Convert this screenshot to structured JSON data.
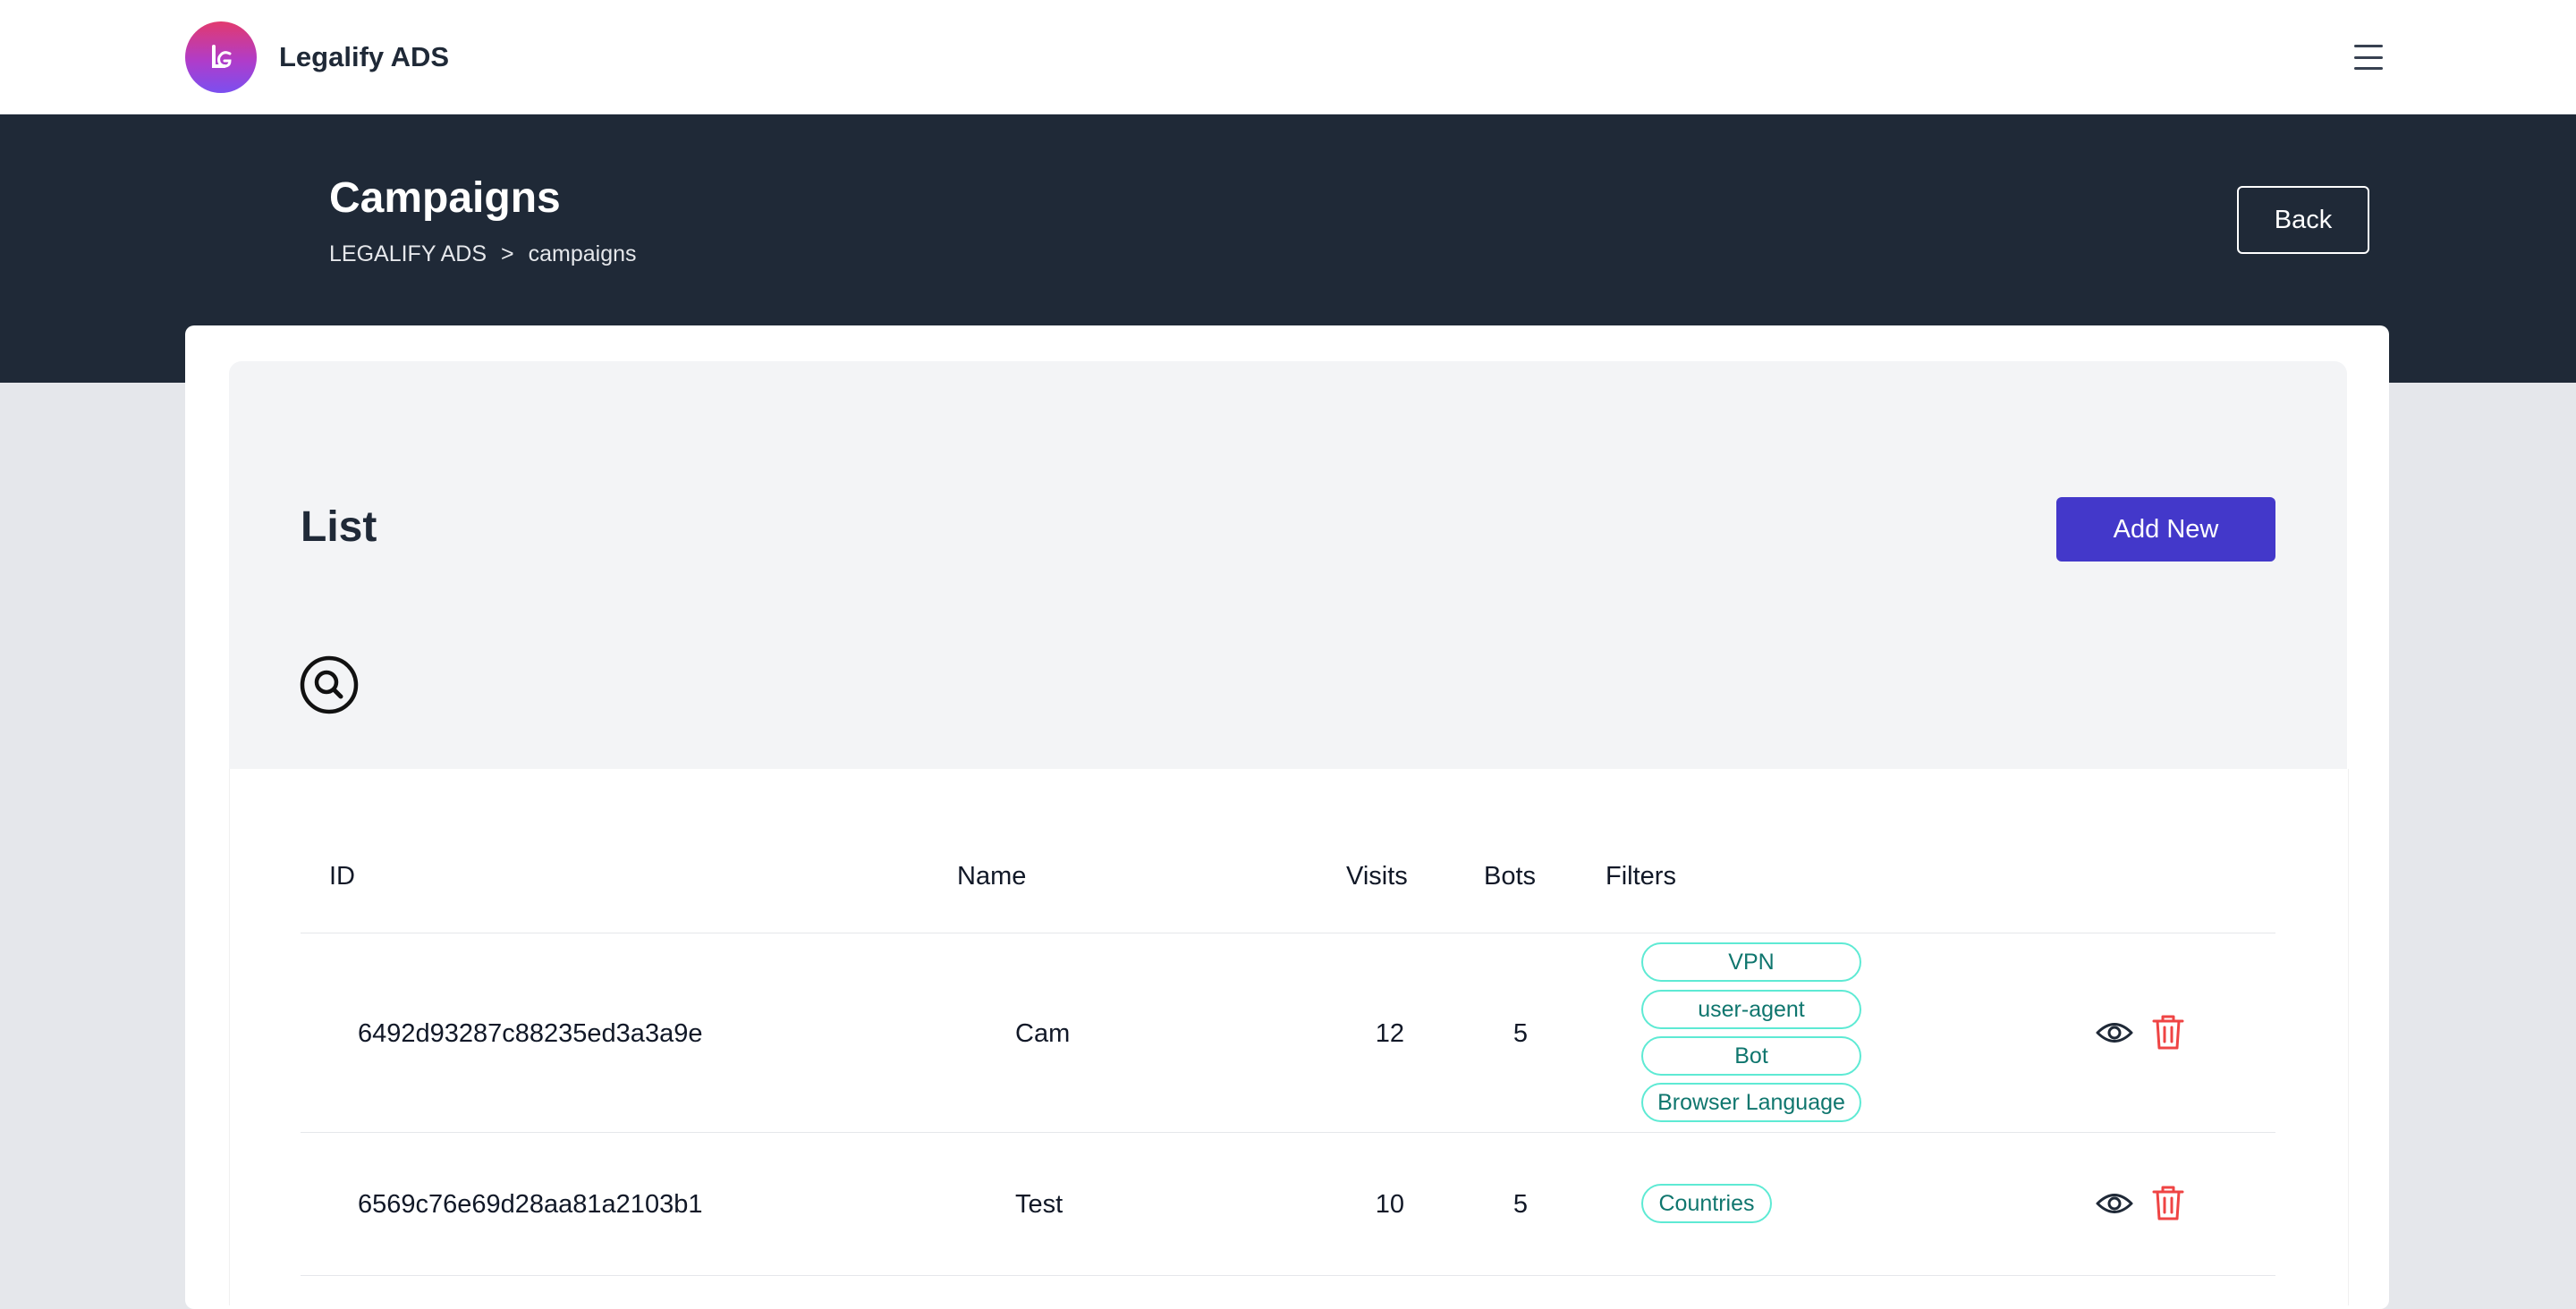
{
  "brand": {
    "name": "Legalify ADS",
    "logo_letter": "LG"
  },
  "header": {
    "title": "Campaigns",
    "breadcrumb": [
      "LEGALIFY ADS",
      ">",
      "campaigns"
    ],
    "back_label": "Back"
  },
  "list": {
    "title": "List",
    "add_label": "Add New"
  },
  "table": {
    "columns": [
      "ID",
      "Name",
      "Visits",
      "Bots",
      "Filters"
    ],
    "rows": [
      {
        "id": "6492d93287c88235ed3a3a9e",
        "name": "Cam",
        "visits": "12",
        "bots": "5",
        "filters": [
          "VPN",
          "user-agent",
          "Bot",
          "Browser Language"
        ]
      },
      {
        "id": "6569c76e69d28aa81a2103b1",
        "name": "Test",
        "visits": "10",
        "bots": "5",
        "filters": [
          "Countries"
        ]
      }
    ]
  },
  "icons": {
    "menu": "hamburger-menu-icon",
    "search": "search-icon",
    "view": "eye-icon",
    "delete": "trash-icon"
  },
  "colors": {
    "header_bg": "#1f2937",
    "accent": "#4338ca",
    "tag_border": "#5eead4",
    "tag_text": "#0f766e",
    "delete": "#ef4444"
  }
}
